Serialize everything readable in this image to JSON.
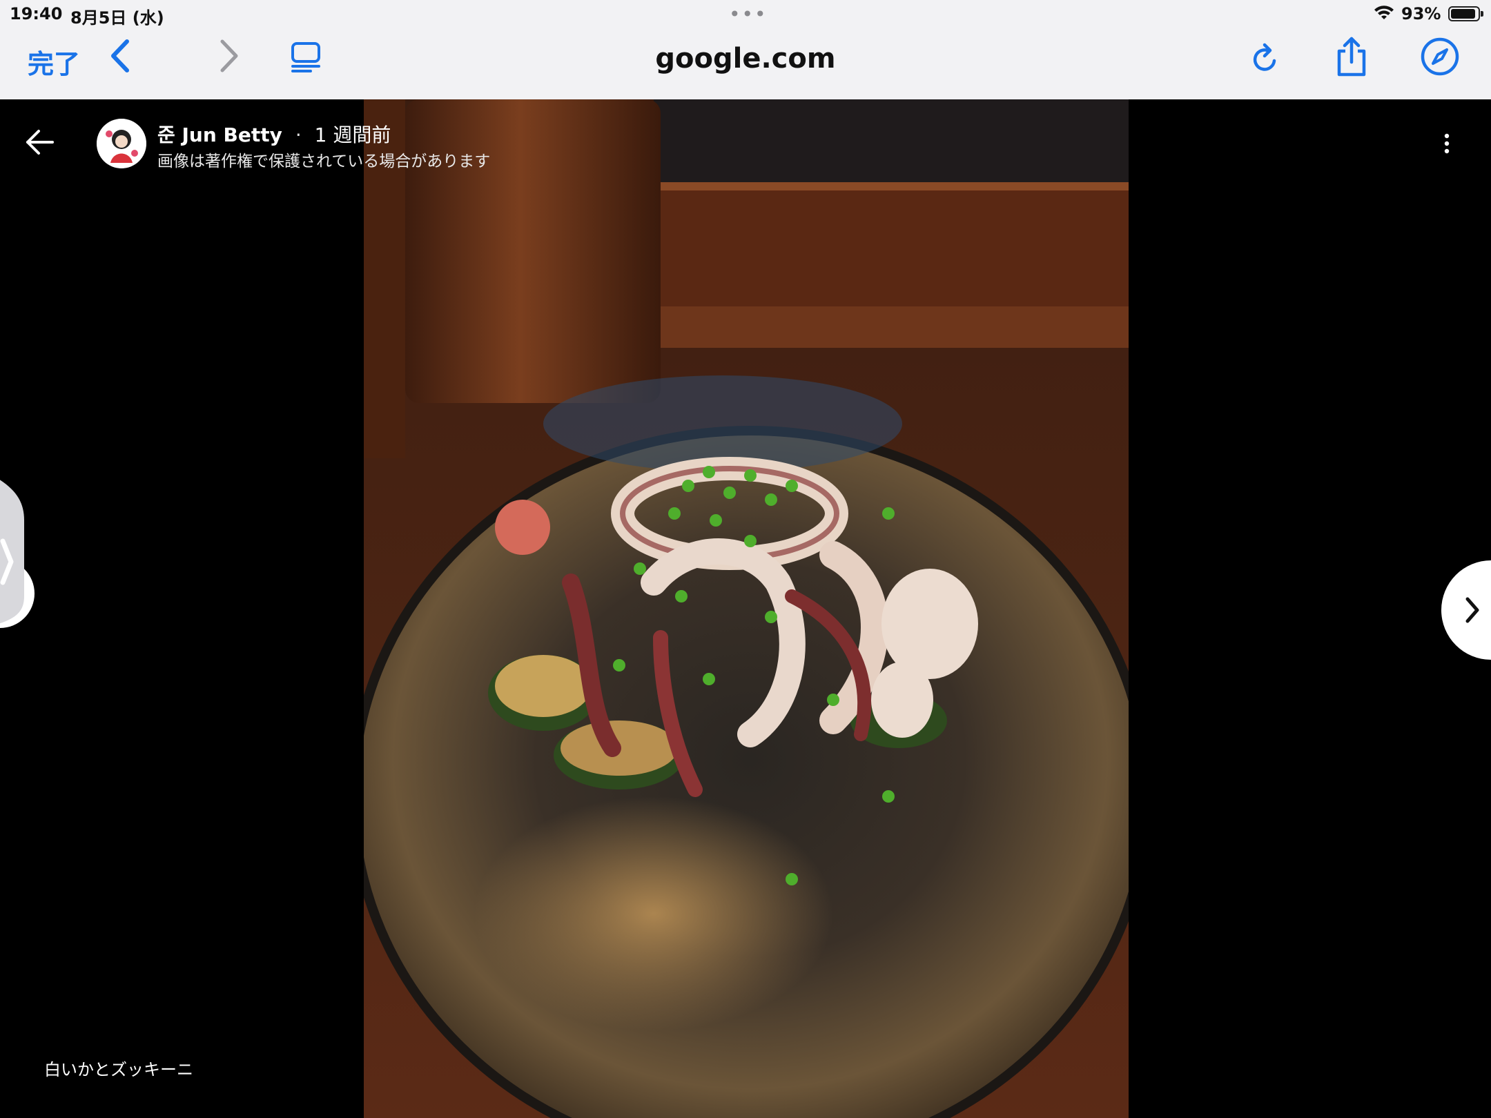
{
  "status_bar": {
    "time": "19:40",
    "date": "8月5日 (水)",
    "battery": "93%",
    "battery_level": 0.93
  },
  "toolbar": {
    "done_label": "完了",
    "url": "google.com"
  },
  "viewer": {
    "author_name": "준 Jun Betty",
    "separator": "·",
    "posted": "1 週間前",
    "copyright_notice": "画像は著作権で保護されている場合があります",
    "caption": "白いかとズッキーニ"
  },
  "colors": {
    "accent": "#1a73e8",
    "chrome_bg": "#f2f2f4",
    "viewer_bg": "#000000"
  },
  "icons": [
    "back-icon",
    "forward-icon",
    "tabs-icon",
    "reload-icon",
    "share-icon",
    "compass-icon",
    "arrow-left-icon",
    "more-vertical-icon",
    "chevron-right-icon",
    "wifi-icon"
  ]
}
